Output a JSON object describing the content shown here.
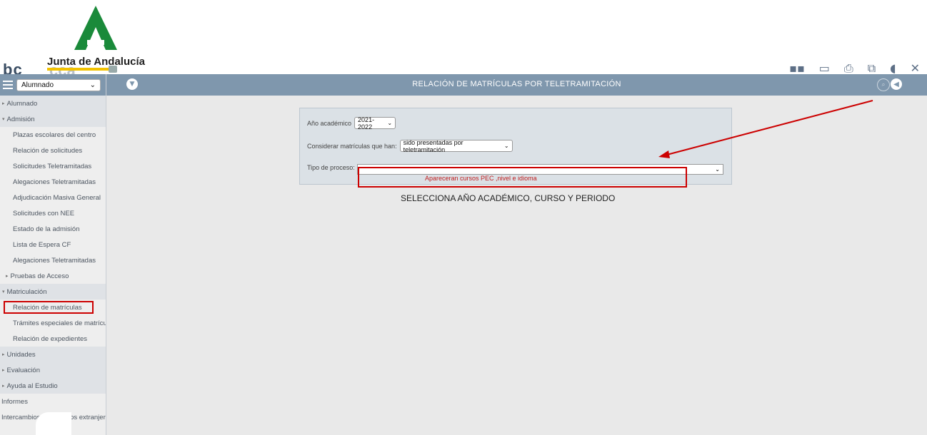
{
  "header": {
    "brand": "Junta de Andalucía",
    "app_fragment": "bc",
    "app_fragment_2": "cca",
    "icons": [
      "app-icon",
      "chat-icon",
      "print-icon",
      "window-icon",
      "user-icon",
      "close-icon"
    ]
  },
  "sidebar": {
    "profile_select": "Alumnado",
    "items": [
      {
        "label": "Alumnado",
        "kind": "section",
        "marker": "▸"
      },
      {
        "label": "Admisión",
        "kind": "section",
        "marker": "▾"
      },
      {
        "label": "Plazas escolares del centro",
        "kind": "sub"
      },
      {
        "label": "Relación de solicitudes",
        "kind": "sub"
      },
      {
        "label": "Solicitudes Teletramitadas",
        "kind": "sub"
      },
      {
        "label": "Alegaciones Teletramitadas",
        "kind": "sub"
      },
      {
        "label": "Adjudicación Masiva General",
        "kind": "sub"
      },
      {
        "label": "Solicitudes con NEE",
        "kind": "sub"
      },
      {
        "label": "Estado de la admisión",
        "kind": "sub"
      },
      {
        "label": "Lista de Espera CF",
        "kind": "sub"
      },
      {
        "label": "Alegaciones Teletramitadas",
        "kind": "sub"
      },
      {
        "label": "Pruebas de Acceso",
        "kind": "subsection",
        "marker": "▸"
      },
      {
        "label": "Matriculación",
        "kind": "section",
        "marker": "▾"
      },
      {
        "label": "Relación de matrículas",
        "kind": "sub",
        "active": true
      },
      {
        "label": "Trámites especiales de matrículas",
        "kind": "sub"
      },
      {
        "label": "Relación de expedientes",
        "kind": "sub"
      },
      {
        "label": "Unidades",
        "kind": "section",
        "marker": "▸"
      },
      {
        "label": "Evaluación",
        "kind": "section",
        "marker": "▸"
      },
      {
        "label": "Ayuda al Estudio",
        "kind": "section",
        "marker": "▸"
      },
      {
        "label": "Informes",
        "kind": "top"
      },
      {
        "label": "Intercambios con centros extranjeros",
        "kind": "top"
      }
    ]
  },
  "main": {
    "title": "RELACIÓN DE MATRÍCULAS POR TELETRAMITACIÓN",
    "form": {
      "year_label": "Año académico",
      "year_value": "2021-2022",
      "consider_label": "Considerar matrículas que han:",
      "consider_value": "sido presentadas por teletramitación",
      "tipo_label": "Tipo de proceso:",
      "tipo_value": ""
    },
    "annotation_text": "Apareceran cursos PEC ,nivel e idioma",
    "instruction": "SELECCIONA AÑO ACADÉMICO, CURSO Y PERIODO"
  },
  "colors": {
    "header_bar": "#7f97ad",
    "annotation": "#cc0000",
    "brand_green": "#1a8a3a"
  }
}
